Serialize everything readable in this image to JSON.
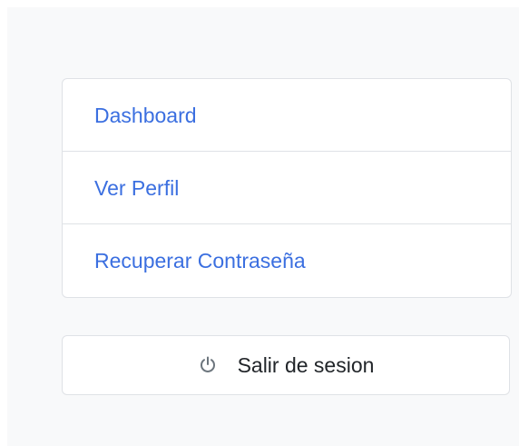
{
  "menu": {
    "items": [
      {
        "label": "Dashboard"
      },
      {
        "label": "Ver Perfil"
      },
      {
        "label": "Recuperar Contraseña"
      }
    ]
  },
  "logout": {
    "label": "Salir de sesion",
    "icon": "power-icon"
  },
  "colors": {
    "link": "#3b6fe0",
    "text": "#212529",
    "border": "#dfe2e6",
    "background": "#f8f9fa",
    "icon": "#6c757d"
  }
}
